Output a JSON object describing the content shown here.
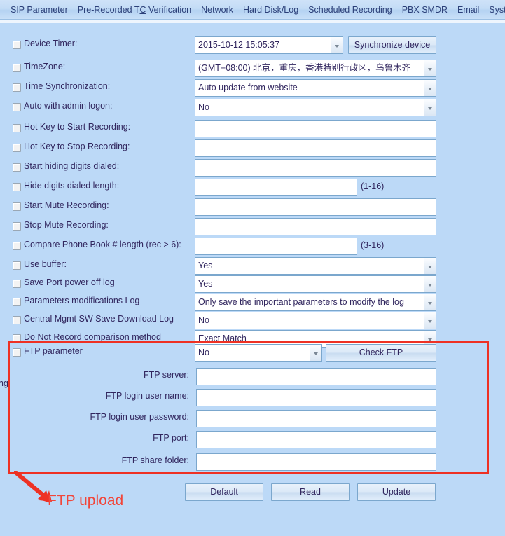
{
  "tabs": [
    {
      "label": "SIP Parameter"
    },
    {
      "label": "Pre-Recorded TC Verification"
    },
    {
      "label": "Network"
    },
    {
      "label": "Hard Disk/Log"
    },
    {
      "label": "Scheduled Recording"
    },
    {
      "label": "PBX SMDR"
    },
    {
      "label": "Email"
    },
    {
      "label": "System"
    }
  ],
  "rows": [
    {
      "label": "Device Timer:",
      "kind": "select",
      "value": "2015-10-12 15:05:37"
    },
    {
      "label": "TimeZone:",
      "kind": "select",
      "value": "(GMT+08:00) 北京，重庆，香港特别行政区，乌鲁木齐"
    },
    {
      "label": "Time Synchronization:",
      "kind": "select",
      "value": "Auto update from website"
    },
    {
      "label": "Auto with admin logon:",
      "kind": "select",
      "value": "No"
    },
    {
      "label": "Hot Key to Start Recording:",
      "kind": "text",
      "value": ""
    },
    {
      "label": "Hot Key to Stop Recording:",
      "kind": "text",
      "value": ""
    },
    {
      "label": "Start hiding digits dialed:",
      "kind": "text",
      "value": ""
    },
    {
      "label": "Hide digits dialed length:",
      "kind": "text-short",
      "value": "",
      "hint": "(1-16)"
    },
    {
      "label": "Start Mute Recording:",
      "kind": "text",
      "value": ""
    },
    {
      "label": "Stop Mute Recording:",
      "kind": "text",
      "value": ""
    },
    {
      "label": "Compare Phone Book # length (rec > 6):",
      "kind": "text-short",
      "value": "",
      "hint": "(3-16)"
    },
    {
      "label": "Use buffer:",
      "kind": "select",
      "value": "Yes"
    },
    {
      "label": "Save Port power off log",
      "kind": "select",
      "value": "Yes"
    },
    {
      "label": "Parameters modifications Log",
      "kind": "select",
      "value": "Only save the important parameters to modify the log"
    },
    {
      "label": "Central Mgmt SW Save Download Log",
      "kind": "select",
      "value": "No"
    },
    {
      "label": "Do Not Record comparison method",
      "kind": "select",
      "value": "Exact Match"
    }
  ],
  "sync_button": {
    "label": "Synchronize device"
  },
  "ftp": {
    "parameter_label": "FTP parameter",
    "parameter_value": "No",
    "check_button": "Check FTP",
    "fields": [
      {
        "label": "FTP server:",
        "value": ""
      },
      {
        "label": "FTP login user name:",
        "value": ""
      },
      {
        "label": "FTP login user password:",
        "value": ""
      },
      {
        "label": "FTP port:",
        "value": ""
      },
      {
        "label": "FTP share folder:",
        "value": ""
      }
    ]
  },
  "cutoff_text": "ng",
  "footer_buttons": [
    {
      "label": "Default"
    },
    {
      "label": "Read"
    },
    {
      "label": "Update"
    }
  ],
  "annotation": {
    "text": "FTP upload",
    "color": "#f1463a"
  }
}
